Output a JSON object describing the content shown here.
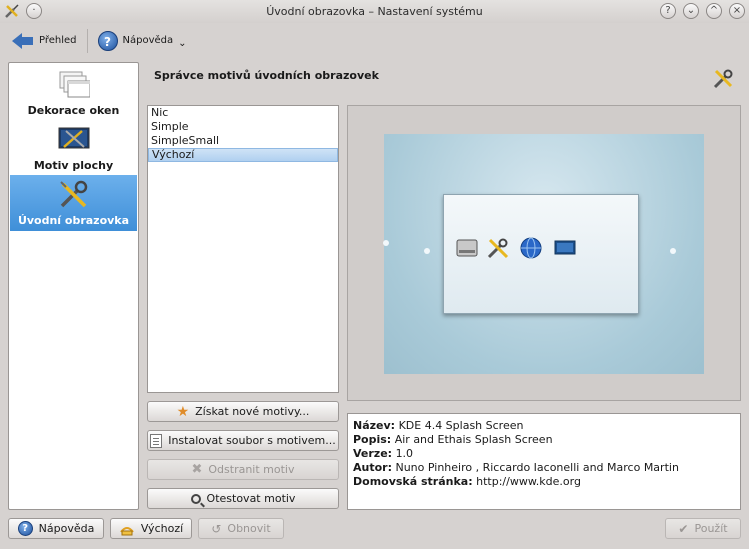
{
  "window": {
    "title": "Úvodní obrazovka – Nastavení systému",
    "buttons": [
      "?",
      "⌄",
      "^",
      "×"
    ]
  },
  "toolbar": {
    "back_label": "Přehled",
    "help_label": "Nápověda",
    "help_arrow": "⌄"
  },
  "sidebar": {
    "items": [
      {
        "label": "Dekorace oken",
        "icon": "window-decoration-icon",
        "active": false
      },
      {
        "label": "Motiv plochy",
        "icon": "desktop-theme-icon",
        "active": false
      },
      {
        "label": "Úvodní obrazovka",
        "icon": "tools-icon",
        "active": true
      }
    ]
  },
  "main": {
    "section_title": "Správce motivů úvodních obrazovek",
    "themes": [
      "Nic",
      "Simple",
      "SimpleSmall",
      "Výchozí"
    ],
    "selected_theme_index": 3,
    "buttons": {
      "get_new": "Získat nové motivy...",
      "install": "Instalovat soubor s motivem...",
      "remove": "Odstranit motiv",
      "test": "Otestovat motiv"
    },
    "info": {
      "name_label": "Název:",
      "name_value": "KDE 4.4 Splash Screen",
      "desc_label": "Popis:",
      "desc_value": "Air and Ethais Splash Screen",
      "version_label": "Verze:",
      "version_value": "1.0",
      "author_label": "Autor:",
      "author_value": "Nuno Pinheiro , Riccardo Iaconelli and Marco Martin",
      "home_label": "Domovská stránka:",
      "home_value": "http://www.kde.org"
    }
  },
  "footer": {
    "help": "Nápověda",
    "defaults": "Výchozí",
    "reset": "Obnovit",
    "apply": "Použít"
  },
  "colors": {
    "accent": "#3f8fd8",
    "selection": "#b0d0f0",
    "background": "#d6d2d0"
  }
}
